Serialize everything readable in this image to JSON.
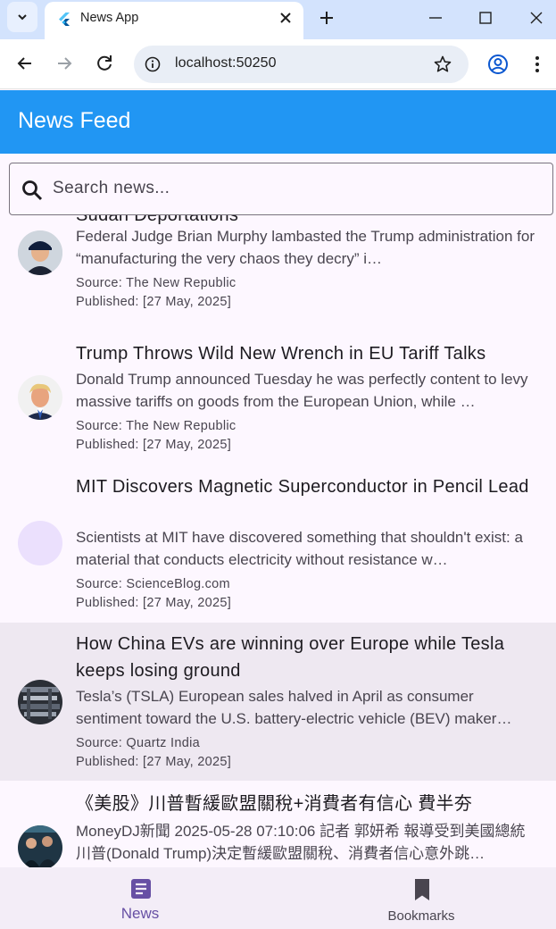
{
  "browser": {
    "tab_title": "News App",
    "url": "localhost:50250"
  },
  "app": {
    "title": "News Feed",
    "search_placeholder": "Search news..."
  },
  "articles": [
    {
      "title": "Sudan Deportations",
      "description": "Federal Judge Brian Murphy lambasted the Trump administration for “manufacturing the very chaos they decry” i…",
      "source": "Source: The New Republic",
      "published": "Published: [27 May, 2025]"
    },
    {
      "title": "Trump Throws Wild New Wrench in EU Tariff Talks",
      "description": "Donald Trump announced Tuesday he was perfectly content to levy massive tariffs on goods from the European Union, while …",
      "source": "Source: The New Republic",
      "published": "Published: [27 May, 2025]"
    },
    {
      "title": "MIT Discovers Magnetic Superconductor in Pencil Lead",
      "description": "Scientists at MIT have discovered something that shouldn't exist: a material that conducts electricity without resistance w…",
      "source": "Source: ScienceBlog.com",
      "published": "Published: [27 May, 2025]"
    },
    {
      "title": "How China EVs are winning over Europe while Tesla keeps losing ground",
      "description": "Tesla’s (TSLA) European sales halved in April as consumer sentiment toward the U.S. battery-electric vehicle (BEV) maker…",
      "source": "Source: Quartz India",
      "published": "Published: [27 May, 2025]"
    },
    {
      "title": "《美股》川普暫緩歐盟關稅+消費者有信心 費半夯",
      "description": "MoneyDJ新聞 2025-05-28 07:10:06 記者 郭妍希 報導受到美國總統川普(Donald Trump)決定暫緩歐盟關稅、消費者信心意外跳…",
      "source": "",
      "published": ""
    }
  ],
  "bottom_nav": {
    "news_label": "News",
    "bookmarks_label": "Bookmarks"
  },
  "colors": {
    "app_bar": "#2196f3",
    "highlight": "#eee8f1",
    "nav_active": "#6750a4"
  }
}
